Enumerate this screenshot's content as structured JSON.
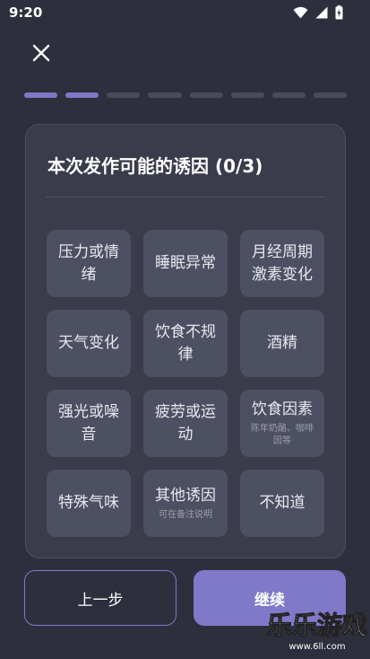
{
  "status_bar": {
    "time": "9:20"
  },
  "progress": {
    "total_steps": 8,
    "completed_steps": 2
  },
  "card": {
    "title": "本次发作可能的诱因 (0/3)",
    "options": [
      {
        "label": "压力或情绪",
        "sub": ""
      },
      {
        "label": "睡眠异常",
        "sub": ""
      },
      {
        "label": "月经周期激素变化",
        "sub": ""
      },
      {
        "label": "天气变化",
        "sub": ""
      },
      {
        "label": "饮食不规律",
        "sub": ""
      },
      {
        "label": "酒精",
        "sub": ""
      },
      {
        "label": "强光或噪音",
        "sub": ""
      },
      {
        "label": "疲劳或运动",
        "sub": ""
      },
      {
        "label": "饮食因素",
        "sub": "陈年奶酪、咖啡因等"
      },
      {
        "label": "特殊气味",
        "sub": ""
      },
      {
        "label": "其他诱因",
        "sub": "可在备注说明"
      },
      {
        "label": "不知道",
        "sub": ""
      }
    ]
  },
  "buttons": {
    "prev_label": "上一步",
    "next_label": "继续"
  },
  "watermark": {
    "title": "乐乐游戏",
    "url": "www.6ll.com"
  },
  "colors": {
    "accent": "#8078c8",
    "background": "#2e2f3d",
    "card": "#3a3b4b",
    "option": "#4d5062"
  }
}
